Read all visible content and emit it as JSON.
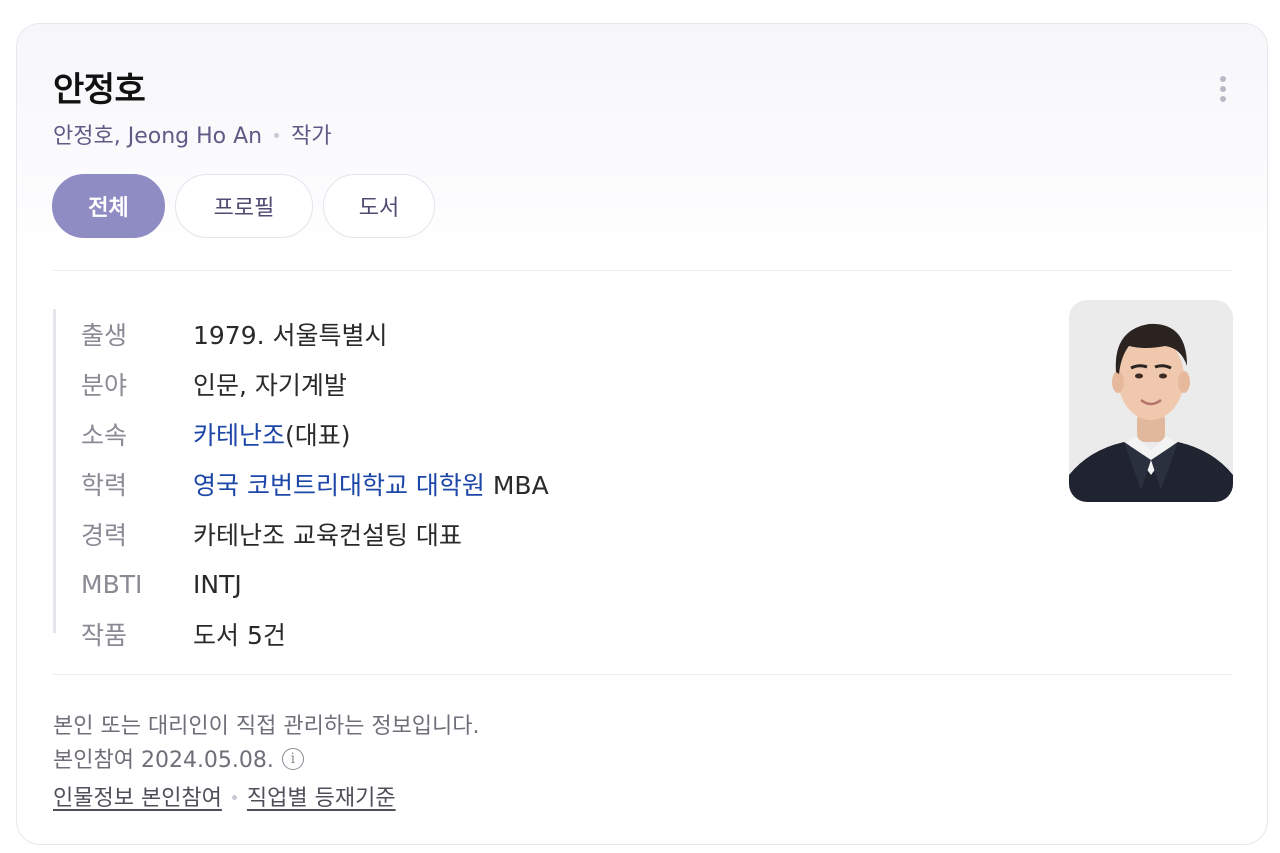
{
  "person": {
    "name": "안정호",
    "aliases": "안정호, Jeong Ho An",
    "occupation": "작가"
  },
  "tabs": [
    {
      "label": "전체",
      "active": true
    },
    {
      "label": "프로필",
      "active": false
    },
    {
      "label": "도서",
      "active": false
    }
  ],
  "profile": {
    "birth": {
      "label": "출생",
      "value": "1979. 서울특별시"
    },
    "field": {
      "label": "분야",
      "value": "인문, 자기계발"
    },
    "affiliation": {
      "label": "소속",
      "link": "카테난조",
      "suffix": "(대표)"
    },
    "education": {
      "label": "학력",
      "link": "영국 코번트리대학교 대학원",
      "suffix": " MBA"
    },
    "career": {
      "label": "경력",
      "value": "카테난조 교육컨설팅 대표"
    },
    "mbti": {
      "label": "MBTI",
      "value": "INTJ"
    },
    "works": {
      "label": "작품",
      "link": "도서 5건"
    }
  },
  "footer": {
    "note": "본인 또는 대리인이 직접 관리하는 정보입니다.",
    "participation": "본인참여 2024.05.08.",
    "info_icon": "i",
    "link_participate": "인물정보 본인참여",
    "link_criteria": "직업별 등재기준"
  },
  "colors": {
    "accent": "#8f8cc4",
    "link": "#1c46a8",
    "subtitle": "#5f5b86"
  },
  "icons": {
    "more": "more-vertical-icon",
    "info": "info-circle-icon"
  }
}
